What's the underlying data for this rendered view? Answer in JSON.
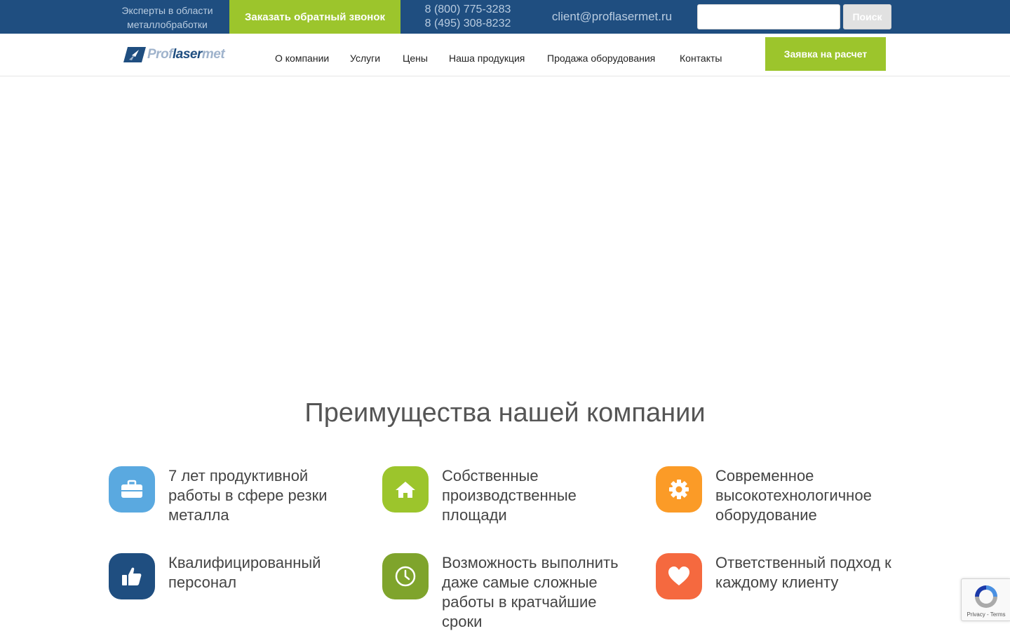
{
  "topbar": {
    "tagline": "Эксперты в области металлобработки",
    "callback_label": "Заказать обратный звонок",
    "phone_1": "8 (800) 775-3283",
    "phone_2": "8 (495) 308-8232",
    "email": "client@proflasermet.ru",
    "search_placeholder": "",
    "search_label": "Поиск"
  },
  "logo": {
    "part_1": "Prof",
    "part_2": "laser",
    "part_3": "met"
  },
  "nav": {
    "items": [
      {
        "label": "О компании"
      },
      {
        "label": "Услуги"
      },
      {
        "label": "Цены"
      },
      {
        "label": "Наша продукция"
      },
      {
        "label": "Продажа оборудования"
      },
      {
        "label": "Контакты"
      }
    ],
    "order_label": "Заявка на расчет"
  },
  "advantages": {
    "title": "Преимущества нашей компании",
    "items": [
      {
        "text": "7 лет продуктивной работы в сфере резки металла",
        "icon": "briefcase-icon",
        "color": "#5aa9e0"
      },
      {
        "text": "Собственные производственные площади",
        "icon": "home-icon",
        "color": "#9cc52c"
      },
      {
        "text": "Современное высокотехнологичное оборудование",
        "icon": "gear-icon",
        "color": "#fb9b27"
      },
      {
        "text": "Квалифицированный персонал",
        "icon": "thumbs-up-icon",
        "color": "#1f4e80"
      },
      {
        "text": "Возможность выполнить даже самые сложные работы в кратчайшие сроки",
        "icon": "clock-icon",
        "color": "#7fa42c"
      },
      {
        "text": "Ответственный подход к каждому клиенту",
        "icon": "heart-icon",
        "color": "#f5693f"
      }
    ]
  },
  "recaptcha": {
    "links": "Privacy - Terms"
  }
}
